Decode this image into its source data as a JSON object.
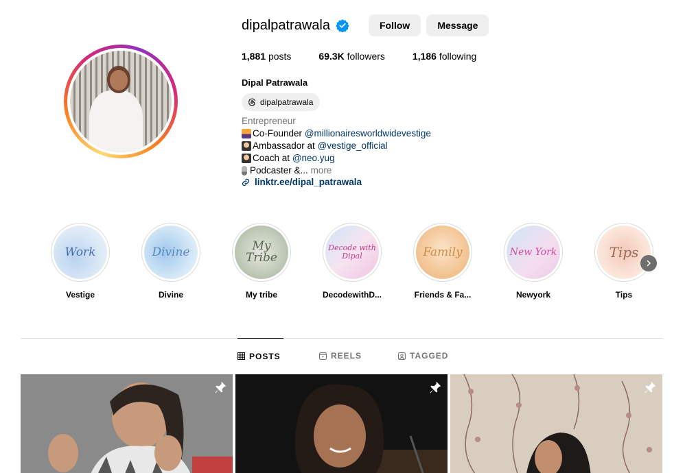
{
  "profile": {
    "username": "dipalpatrawala",
    "follow_label": "Follow",
    "message_label": "Message",
    "stats": {
      "posts_count": "1,881",
      "posts_label": "posts",
      "followers_count": "69.3K",
      "followers_label": "followers",
      "following_count": "1,186",
      "following_label": "following"
    },
    "full_name": "Dipal Patrawala",
    "threads_handle": "dipalpatrawala",
    "category": "Entrepreneur",
    "bio": {
      "line1_text": "Co-Founder ",
      "line1_mention": "@millionairesworldwidevestige",
      "line2_text": "Ambassador at ",
      "line2_mention": "@vestige_official",
      "line3_text": "Coach at ",
      "line3_mention": "@neo.yug",
      "line4_text": "Podcaster &...",
      "more_label": "more"
    },
    "link": "linktr.ee/dipal_patrawala"
  },
  "highlights": [
    {
      "label": "Vestige",
      "cover_text": "Work",
      "color": "#4a6fb0",
      "bg1": "#dbe8f6",
      "bg2": "#b8d3ef"
    },
    {
      "label": "Divine",
      "cover_text": "Divine",
      "color": "#5a88c0",
      "bg1": "#d3e6f6",
      "bg2": "#9fc8ec"
    },
    {
      "label": "My tribe",
      "cover_text": "My Tribe",
      "color": "#5a6450",
      "bg1": "#e4e8e0",
      "bg2": "#b9c3b0"
    },
    {
      "label": "DecodewithD...",
      "cover_text": "Decode with Dipal",
      "color": "#c03a8a",
      "bg1": "#f6e4f0",
      "bg2": "#cfe3f7"
    },
    {
      "label": "Friends & Fa...",
      "cover_text": "Family",
      "color": "#d08a40",
      "bg1": "#fbe3c8",
      "bg2": "#f2c08e"
    },
    {
      "label": "Newyork",
      "cover_text": "New York",
      "color": "#d04a9a",
      "bg1": "#f5ddef",
      "bg2": "#cfe6f7"
    },
    {
      "label": "Tips",
      "cover_text": "Tips",
      "color": "#9a6a5a",
      "bg1": "#fbe6dc",
      "bg2": "#f3c7b6"
    }
  ],
  "tabs": {
    "posts": "POSTS",
    "reels": "REELS",
    "tagged": "TAGGED"
  },
  "colors": {
    "verified_blue": "#0095f6",
    "link_blue": "#00376b",
    "muted": "#737373",
    "button_bg": "#efefef"
  }
}
